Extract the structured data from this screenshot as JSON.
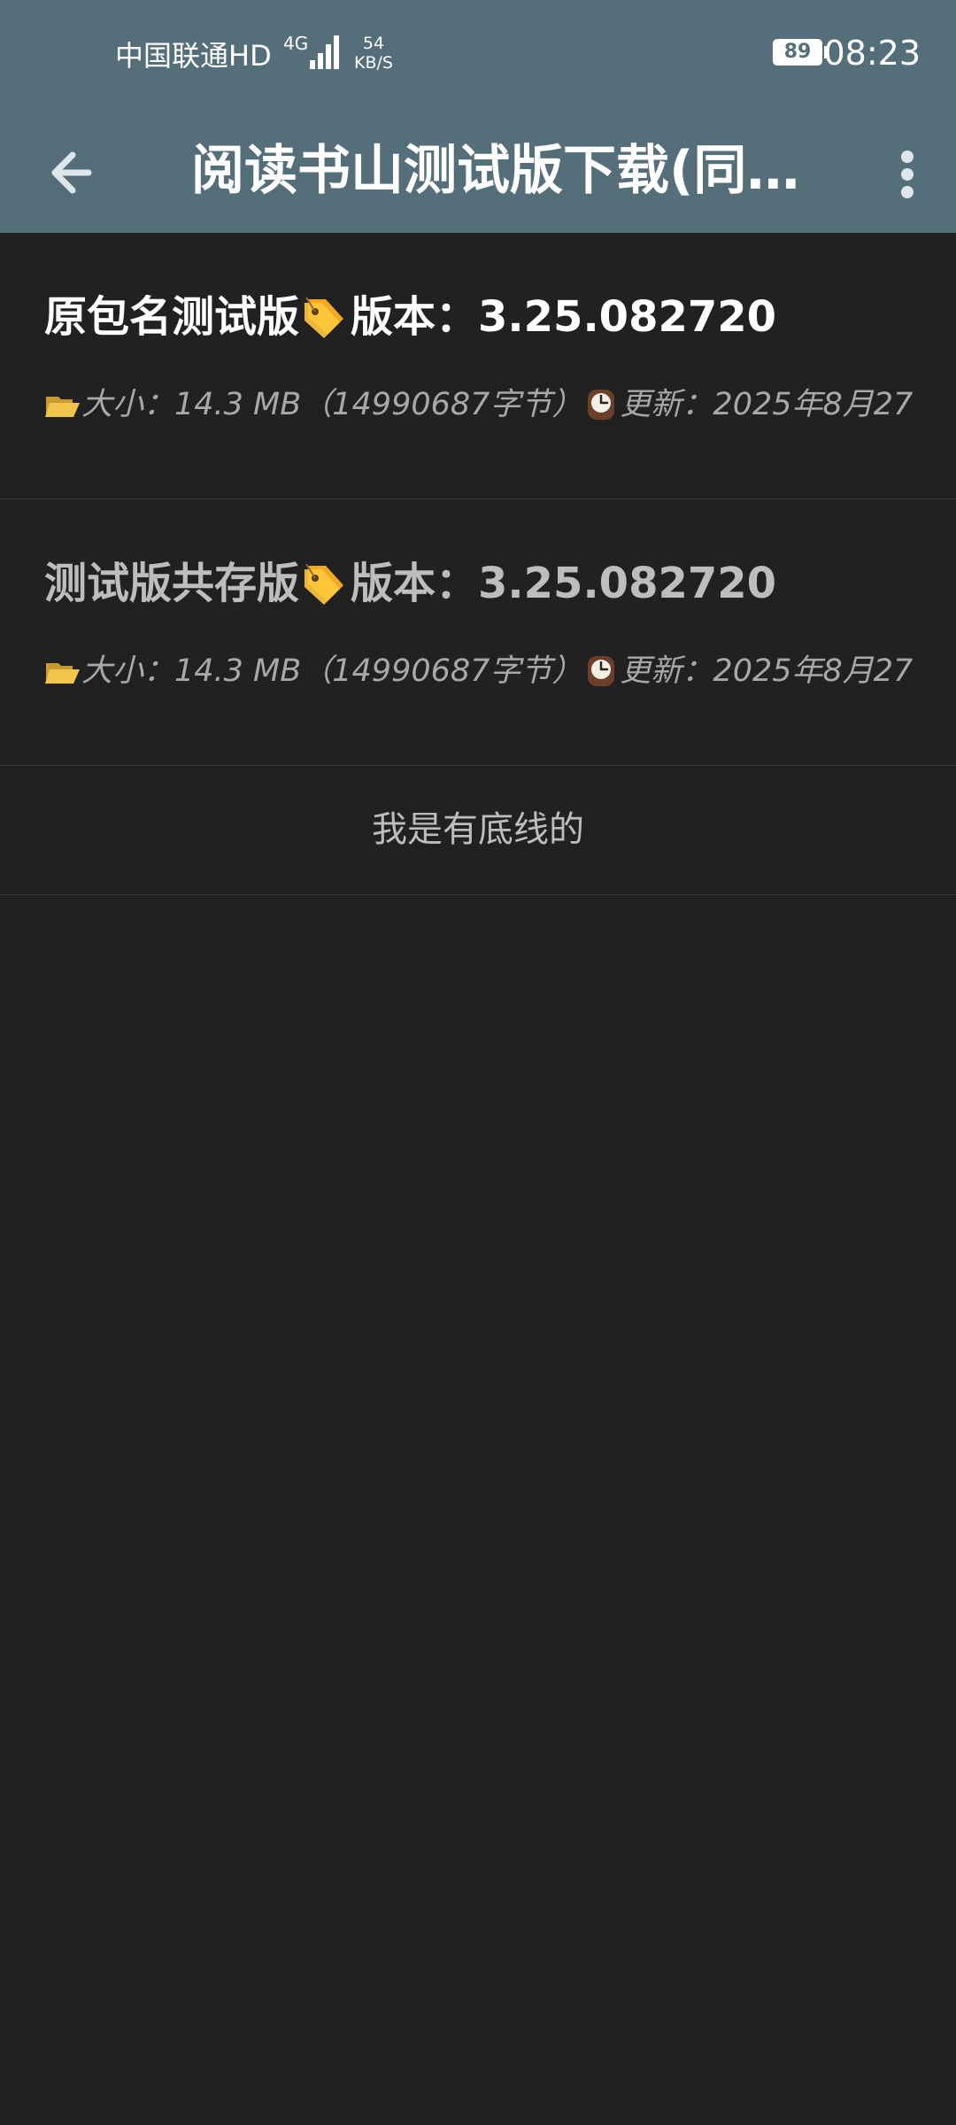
{
  "status_bar": {
    "carrier": "中国联通HD",
    "network_type": "4G",
    "speed_value": "54",
    "speed_unit": "KB/S",
    "battery": "89",
    "time": "08:23"
  },
  "toolbar": {
    "title": "阅读书山测试版下载(同…"
  },
  "items": [
    {
      "name": "原包名测试版",
      "version_label": "版本：3.25.082720",
      "meta_size": "大小：14.3 MB（14990687字节）",
      "meta_update": "更新：2025年8月27"
    },
    {
      "name": "测试版共存版",
      "version_label": "版本：3.25.082720",
      "meta_size": "大小：14.3 MB（14990687字节）",
      "meta_update": "更新：2025年8月27"
    }
  ],
  "footer": {
    "text": "我是有底线的"
  },
  "colors": {
    "toolbar_bg": "#546e7a",
    "page_bg": "#212121",
    "text_primary": "#ffffff",
    "text_secondary": "#a8a8a8"
  }
}
